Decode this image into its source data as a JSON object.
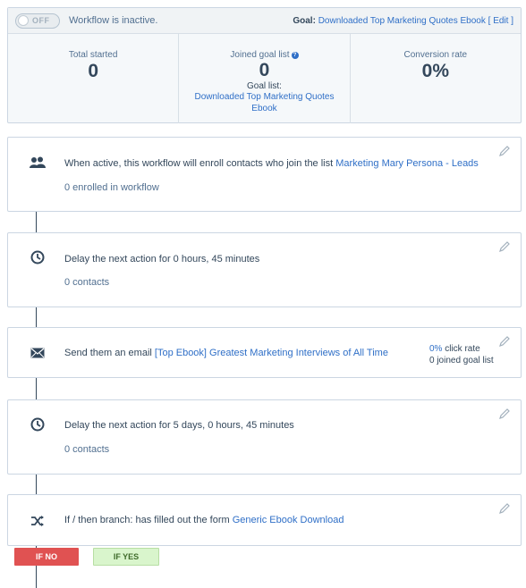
{
  "header": {
    "toggle_label": "OFF",
    "status": "Workflow is inactive.",
    "goal_label": "Goal:",
    "goal_link": "Downloaded Top Marketing Quotes Ebook",
    "edit_link": "[ Edit ]"
  },
  "stats": {
    "total_started": {
      "title": "Total started",
      "value": "0"
    },
    "joined_goal": {
      "title": "Joined goal list",
      "value": "0",
      "list_label": "Goal list:",
      "list_link": "Downloaded Top Marketing Quotes Ebook"
    },
    "conversion": {
      "title": "Conversion rate",
      "value": "0%"
    }
  },
  "steps": [
    {
      "icon": "contacts-icon",
      "text": "When active, this workflow will enroll contacts who join the list ",
      "link": "Marketing Mary Persona - Leads",
      "sub": "0 enrolled in workflow"
    },
    {
      "icon": "clock-icon",
      "text": "Delay the next action for 0 hours, 45 minutes",
      "sub": "0 contacts"
    },
    {
      "icon": "envelope-icon",
      "text": "Send them an email ",
      "link": "[Top Ebook] Greatest Marketing Interviews of All Time",
      "click_rate_value": "0%",
      "click_rate_label": " click rate",
      "joined_goal": "0 joined goal list"
    },
    {
      "icon": "clock-icon",
      "text": "Delay the next action for 5 days, 0 hours, 45 minutes",
      "sub": "0 contacts"
    },
    {
      "icon": "branch-icon",
      "text": "If / then branch: has filled out the form ",
      "link": "Generic Ebook Download"
    }
  ],
  "branches": {
    "no_label": "IF NO",
    "yes_label": "IF YES"
  },
  "colors": {
    "link": "#2f6fc7",
    "if_no": "#e05252",
    "if_yes": "#d9f5cc"
  }
}
